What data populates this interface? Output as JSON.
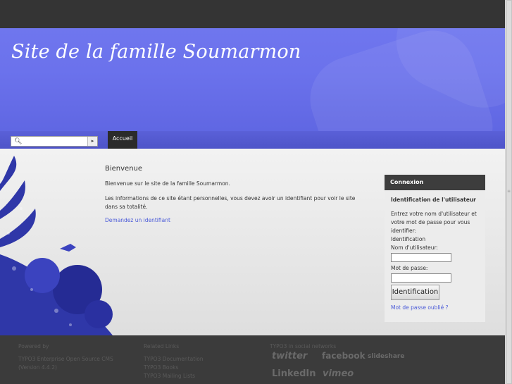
{
  "header": {
    "site_title": "Site de la famille Soumarmon"
  },
  "nav": {
    "home": "Accueil",
    "search_placeholder": ""
  },
  "content": {
    "title": "Bienvenue",
    "p1": "Bienvenue sur le site de la famille Soumarmon.",
    "p2": "Les informations de ce site étant personnelles, vous devez avoir un identifiant pour voir le site dans sa totalité.",
    "link": "Demandez un identifiant"
  },
  "login": {
    "box_title": "Connexion",
    "subtitle": "Identification de l'utilisateur",
    "intro": "Entrez votre nom d'utilisateur et votre mot de passe pour vous identifier:",
    "section": "Identification",
    "user_label": "Nom d'utilisateur:",
    "pass_label": "Mot de passe:",
    "button": "Identification",
    "forgot": "Mot de passe oublié ?"
  },
  "footer": {
    "col1_title": "Powered by",
    "col1_line1": "TYPO3 Enterprise Open Source CMS",
    "col1_line2": "(Version 4.4.2)",
    "col2_title": "Related Links",
    "col2_links": [
      "TYPO3 Documentation",
      "TYPO3 Books",
      "TYPO3 Mailing Lists"
    ],
    "col3_title": "TYPO3 in social networks",
    "social": [
      "twitter",
      "facebook",
      "slideshare",
      "LinkedIn",
      "vimeo"
    ]
  }
}
